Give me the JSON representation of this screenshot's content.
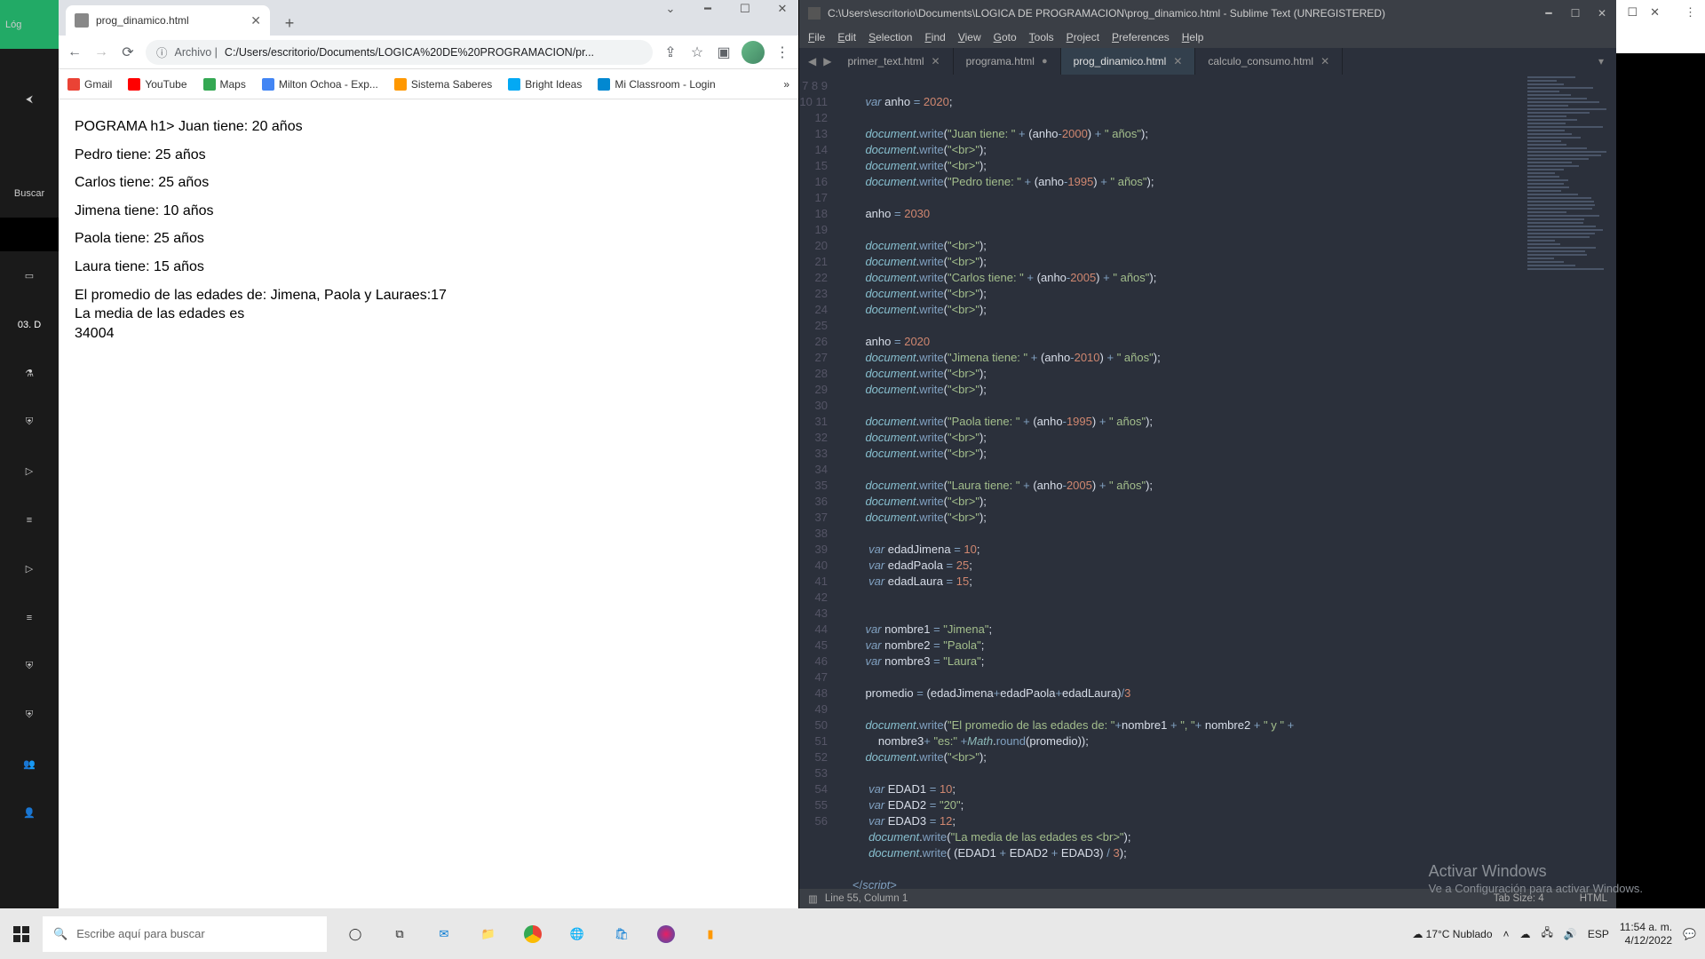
{
  "chrome": {
    "tab_title": "prog_dinamico.html",
    "url_prefix": "Archivo | ",
    "url_path": "C:/Users/escritorio/Documents/LOGICA%20DE%20PROGRAMACION/pr...",
    "bookmarks": [
      "Gmail",
      "YouTube",
      "Maps",
      "Milton Ochoa - Exp...",
      "Sistema Saberes",
      "Bright Ideas",
      "Mi Classroom - Login"
    ],
    "bookmark_colors": [
      "#ea4335",
      "#ff0000",
      "#34a853",
      "#4285f4",
      "#ff9800",
      "#03a9f4",
      "#0288d1"
    ]
  },
  "page": {
    "lines": [
      "POGRAMA h1> Juan tiene: 20 años",
      "Pedro tiene: 25 años",
      "Carlos tiene: 25 años",
      "Jimena tiene: 10 años",
      "Paola tiene: 25 años",
      "Laura tiene: 15 años"
    ],
    "footer": [
      "El promedio de las edades de: Jimena, Paola y Lauraes:17",
      "La media de las edades es",
      "34004"
    ]
  },
  "sublime": {
    "title": "C:\\Users\\escritorio\\Documents\\LOGICA DE PROGRAMACION\\prog_dinamico.html - Sublime Text (UNREGISTERED)",
    "menu": [
      "File",
      "Edit",
      "Selection",
      "Find",
      "View",
      "Goto",
      "Tools",
      "Project",
      "Preferences",
      "Help"
    ],
    "tabs": [
      "primer_text.html",
      "programa.html",
      "prog_dinamico.html",
      "calculo_consumo.html"
    ],
    "active_tab": 2,
    "modified_tab": 1,
    "status_left": "Line 55, Column 1",
    "status_tab": "Tab Size: 4",
    "status_lang": "HTML",
    "first_line": 7,
    "code": [
      "",
      "    <span class='kw'>var</span> <span class='var'>anho</span> <span class='op'>=</span> <span class='num'>2020</span><span class='pun'>;</span>",
      "",
      "    <span class='obj'>document</span><span class='pun'>.</span><span class='fn'>write</span><span class='pun'>(</span><span class='str'>\"Juan tiene: \"</span> <span class='op'>+</span> <span class='pun'>(</span><span class='var'>anho</span><span class='op'>-</span><span class='num'>2000</span><span class='pun'>)</span> <span class='op'>+</span> <span class='str'>\" años\"</span><span class='pun'>);</span>",
      "    <span class='obj'>document</span><span class='pun'>.</span><span class='fn'>write</span><span class='pun'>(</span><span class='str'>\"&lt;br&gt;\"</span><span class='pun'>);</span>",
      "    <span class='obj'>document</span><span class='pun'>.</span><span class='fn'>write</span><span class='pun'>(</span><span class='str'>\"&lt;br&gt;\"</span><span class='pun'>);</span>",
      "    <span class='obj'>document</span><span class='pun'>.</span><span class='fn'>write</span><span class='pun'>(</span><span class='str'>\"Pedro tiene: \"</span> <span class='op'>+</span> <span class='pun'>(</span><span class='var'>anho</span><span class='op'>-</span><span class='num'>1995</span><span class='pun'>)</span> <span class='op'>+</span> <span class='str'>\" años\"</span><span class='pun'>);</span>",
      "",
      "    <span class='var'>anho</span> <span class='op'>=</span> <span class='num'>2030</span>",
      "",
      "    <span class='obj'>document</span><span class='pun'>.</span><span class='fn'>write</span><span class='pun'>(</span><span class='str'>\"&lt;br&gt;\"</span><span class='pun'>);</span>",
      "    <span class='obj'>document</span><span class='pun'>.</span><span class='fn'>write</span><span class='pun'>(</span><span class='str'>\"&lt;br&gt;\"</span><span class='pun'>);</span>",
      "    <span class='obj'>document</span><span class='pun'>.</span><span class='fn'>write</span><span class='pun'>(</span><span class='str'>\"Carlos tiene: \"</span> <span class='op'>+</span> <span class='pun'>(</span><span class='var'>anho</span><span class='op'>-</span><span class='num'>2005</span><span class='pun'>)</span> <span class='op'>+</span> <span class='str'>\" años\"</span><span class='pun'>);</span>",
      "    <span class='obj'>document</span><span class='pun'>.</span><span class='fn'>write</span><span class='pun'>(</span><span class='str'>\"&lt;br&gt;\"</span><span class='pun'>);</span>",
      "    <span class='obj'>document</span><span class='pun'>.</span><span class='fn'>write</span><span class='pun'>(</span><span class='str'>\"&lt;br&gt;\"</span><span class='pun'>);</span>",
      "",
      "    <span class='var'>anho</span> <span class='op'>=</span> <span class='num'>2020</span>",
      "    <span class='obj'>document</span><span class='pun'>.</span><span class='fn'>write</span><span class='pun'>(</span><span class='str'>\"Jimena tiene: \"</span> <span class='op'>+</span> <span class='pun'>(</span><span class='var'>anho</span><span class='op'>-</span><span class='num'>2010</span><span class='pun'>)</span> <span class='op'>+</span> <span class='str'>\" años\"</span><span class='pun'>);</span>",
      "    <span class='obj'>document</span><span class='pun'>.</span><span class='fn'>write</span><span class='pun'>(</span><span class='str'>\"&lt;br&gt;\"</span><span class='pun'>);</span>",
      "    <span class='obj'>document</span><span class='pun'>.</span><span class='fn'>write</span><span class='pun'>(</span><span class='str'>\"&lt;br&gt;\"</span><span class='pun'>);</span>",
      "",
      "    <span class='obj'>document</span><span class='pun'>.</span><span class='fn'>write</span><span class='pun'>(</span><span class='str'>\"Paola tiene: \"</span> <span class='op'>+</span> <span class='pun'>(</span><span class='var'>anho</span><span class='op'>-</span><span class='num'>1995</span><span class='pun'>)</span> <span class='op'>+</span> <span class='str'>\" años\"</span><span class='pun'>);</span>",
      "    <span class='obj'>document</span><span class='pun'>.</span><span class='fn'>write</span><span class='pun'>(</span><span class='str'>\"&lt;br&gt;\"</span><span class='pun'>);</span>",
      "    <span class='obj'>document</span><span class='pun'>.</span><span class='fn'>write</span><span class='pun'>(</span><span class='str'>\"&lt;br&gt;\"</span><span class='pun'>);</span>",
      "",
      "    <span class='obj'>document</span><span class='pun'>.</span><span class='fn'>write</span><span class='pun'>(</span><span class='str'>\"Laura tiene: \"</span> <span class='op'>+</span> <span class='pun'>(</span><span class='var'>anho</span><span class='op'>-</span><span class='num'>2005</span><span class='pun'>)</span> <span class='op'>+</span> <span class='str'>\" años\"</span><span class='pun'>);</span>",
      "    <span class='obj'>document</span><span class='pun'>.</span><span class='fn'>write</span><span class='pun'>(</span><span class='str'>\"&lt;br&gt;\"</span><span class='pun'>);</span>",
      "    <span class='obj'>document</span><span class='pun'>.</span><span class='fn'>write</span><span class='pun'>(</span><span class='str'>\"&lt;br&gt;\"</span><span class='pun'>);</span>",
      "",
      "     <span class='kw'>var</span> <span class='var'>edadJimena</span> <span class='op'>=</span> <span class='num'>10</span><span class='pun'>;</span>",
      "     <span class='kw'>var</span> <span class='var'>edadPaola</span> <span class='op'>=</span> <span class='num'>25</span><span class='pun'>;</span>",
      "     <span class='kw'>var</span> <span class='var'>edadLaura</span> <span class='op'>=</span> <span class='num'>15</span><span class='pun'>;</span>",
      "",
      "",
      "    <span class='kw'>var</span> <span class='var'>nombre1</span> <span class='op'>=</span> <span class='str'>\"Jimena\"</span><span class='pun'>;</span>",
      "    <span class='kw'>var</span> <span class='var'>nombre2</span> <span class='op'>=</span> <span class='str'>\"Paola\"</span><span class='pun'>;</span>",
      "    <span class='kw'>var</span> <span class='var'>nombre3</span> <span class='op'>=</span> <span class='str'>\"Laura\"</span><span class='pun'>;</span>",
      "",
      "    <span class='var'>promedio</span> <span class='op'>=</span> <span class='pun'>(</span><span class='var'>edadJimena</span><span class='op'>+</span><span class='var'>edadPaola</span><span class='op'>+</span><span class='var'>edadLaura</span><span class='pun'>)</span><span class='op'>/</span><span class='num'>3</span>",
      "",
      "    <span class='obj'>document</span><span class='pun'>.</span><span class='fn'>write</span><span class='pun'>(</span><span class='str'>\"El promedio de las edades de: \"</span><span class='op'>+</span><span class='var'>nombre1</span> <span class='op'>+</span> <span class='str'>\", \"</span><span class='op'>+</span> <span class='var'>nombre2</span> <span class='op'>+</span> <span class='str'>\" y \"</span> <span class='op'>+</span>\n        <span class='var'>nombre3</span><span class='op'>+</span> <span class='str'>\"es:\"</span> <span class='op'>+</span><span class='cls'>Math</span><span class='pun'>.</span><span class='fn'>round</span><span class='pun'>(</span><span class='var'>promedio</span><span class='pun'>));</span>",
      "    <span class='obj'>document</span><span class='pun'>.</span><span class='fn'>write</span><span class='pun'>(</span><span class='str'>\"&lt;br&gt;\"</span><span class='pun'>);</span>",
      "",
      "     <span class='kw'>var</span> <span class='var'>EDAD1</span> <span class='op'>=</span> <span class='num'>10</span><span class='pun'>;</span>",
      "     <span class='kw'>var</span> <span class='var'>EDAD2</span> <span class='op'>=</span> <span class='str'>\"20\"</span><span class='pun'>;</span>",
      "     <span class='kw'>var</span> <span class='var'>EDAD3</span> <span class='op'>=</span> <span class='num'>12</span><span class='pun'>;</span>",
      "     <span class='obj'>document</span><span class='pun'>.</span><span class='fn'>write</span><span class='pun'>(</span><span class='str'>\"La media de las edades es &lt;br&gt;\"</span><span class='pun'>);</span>",
      "     <span class='obj'>document</span><span class='pun'>.</span><span class='fn'>write</span><span class='pun'>( (</span><span class='var'>EDAD1</span> <span class='op'>+</span> <span class='var'>EDAD2</span> <span class='op'>+</span> <span class='var'>EDAD3</span><span class='pun'>)</span> <span class='op'>/</span> <span class='num'>3</span><span class='pun'>);</span>",
      "",
      "<span class='op'>&lt;/</span><span class='kw'>script</span><span class='op'>&gt;</span>"
    ]
  },
  "sidebar": {
    "top": "Lóg",
    "search_label": "Buscar",
    "section": "03. D"
  },
  "watermark": {
    "title": "Activar Windows",
    "sub": "Ve a Configuración para activar Windows."
  },
  "taskbar": {
    "search": "Escribe aquí para buscar",
    "weather": "17°C  Nublado",
    "time": "11:54 a. m.",
    "date": "4/12/2022",
    "lang": "ESP"
  }
}
